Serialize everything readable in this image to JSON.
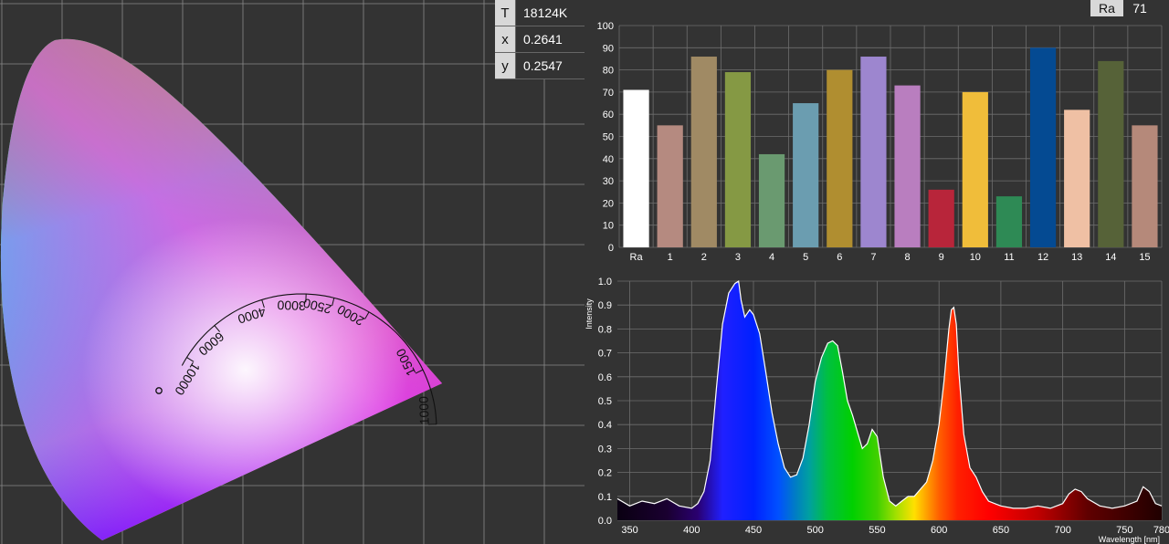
{
  "readout": [
    {
      "key": "T",
      "value": "18124K"
    },
    {
      "key": "x",
      "value": "0.2641"
    },
    {
      "key": "y",
      "value": "0.2547"
    }
  ],
  "ra_box": {
    "key": "Ra",
    "value": "71"
  },
  "chart_data": [
    {
      "type": "scatter",
      "title": "",
      "planckian_locus_labels": [
        "1000",
        "1500",
        "2000",
        "2500",
        "3000",
        "4000",
        "6000",
        "10000"
      ],
      "point": {
        "x": 0.2641,
        "y": 0.2547
      },
      "grid": true
    },
    {
      "type": "bar",
      "title": "",
      "categories": [
        "Ra",
        "1",
        "2",
        "3",
        "4",
        "5",
        "6",
        "7",
        "8",
        "9",
        "10",
        "11",
        "12",
        "13",
        "14",
        "15"
      ],
      "values": [
        71,
        55,
        86,
        79,
        42,
        65,
        80,
        86,
        73,
        26,
        70,
        23,
        90,
        62,
        84,
        55
      ],
      "colors": [
        "#ffffff",
        "#b58a80",
        "#a08a64",
        "#859944",
        "#6a9a70",
        "#6b9db0",
        "#b08e30",
        "#9d86cf",
        "#b97ebf",
        "#b8253a",
        "#f0bd3a",
        "#2e8a55",
        "#044a92",
        "#efc0a4",
        "#566238",
        "#b5897a"
      ],
      "ylim": [
        0,
        100
      ],
      "yticks": [
        0,
        10,
        20,
        30,
        40,
        50,
        60,
        70,
        80,
        90,
        100
      ],
      "grid": true
    },
    {
      "type": "area",
      "title": "",
      "xlabel": "Wavelength [nm]",
      "ylabel": "Intensity",
      "xlim": [
        340,
        780
      ],
      "ylim": [
        0,
        1.0
      ],
      "xticks": [
        350,
        400,
        450,
        500,
        550,
        600,
        650,
        700,
        750,
        780
      ],
      "yticks": [
        "0.0",
        "0.1",
        "0.2",
        "0.3",
        "0.4",
        "0.5",
        "0.6",
        "0.7",
        "0.8",
        "0.9",
        "1.0"
      ],
      "x": [
        340,
        350,
        360,
        370,
        380,
        390,
        400,
        405,
        410,
        415,
        420,
        425,
        430,
        435,
        438,
        440,
        443,
        447,
        450,
        455,
        460,
        465,
        470,
        475,
        480,
        485,
        490,
        495,
        500,
        505,
        510,
        514,
        518,
        522,
        526,
        530,
        534,
        538,
        542,
        546,
        550,
        555,
        560,
        565,
        570,
        575,
        580,
        585,
        590,
        595,
        600,
        604,
        608,
        610,
        612,
        614,
        616,
        620,
        625,
        630,
        635,
        640,
        645,
        650,
        660,
        670,
        680,
        690,
        700,
        705,
        710,
        715,
        720,
        730,
        740,
        750,
        760,
        765,
        770,
        775,
        780
      ],
      "y": [
        0.09,
        0.06,
        0.08,
        0.07,
        0.09,
        0.06,
        0.05,
        0.07,
        0.12,
        0.25,
        0.55,
        0.82,
        0.95,
        0.99,
        1.0,
        0.92,
        0.85,
        0.88,
        0.86,
        0.78,
        0.62,
        0.45,
        0.32,
        0.22,
        0.18,
        0.19,
        0.26,
        0.4,
        0.58,
        0.68,
        0.74,
        0.75,
        0.73,
        0.62,
        0.5,
        0.44,
        0.37,
        0.3,
        0.32,
        0.38,
        0.35,
        0.18,
        0.08,
        0.06,
        0.08,
        0.1,
        0.1,
        0.13,
        0.16,
        0.25,
        0.4,
        0.58,
        0.8,
        0.88,
        0.89,
        0.82,
        0.62,
        0.36,
        0.22,
        0.18,
        0.12,
        0.08,
        0.07,
        0.06,
        0.05,
        0.05,
        0.06,
        0.05,
        0.07,
        0.11,
        0.13,
        0.12,
        0.09,
        0.06,
        0.05,
        0.06,
        0.08,
        0.14,
        0.12,
        0.07,
        0.06
      ]
    }
  ]
}
